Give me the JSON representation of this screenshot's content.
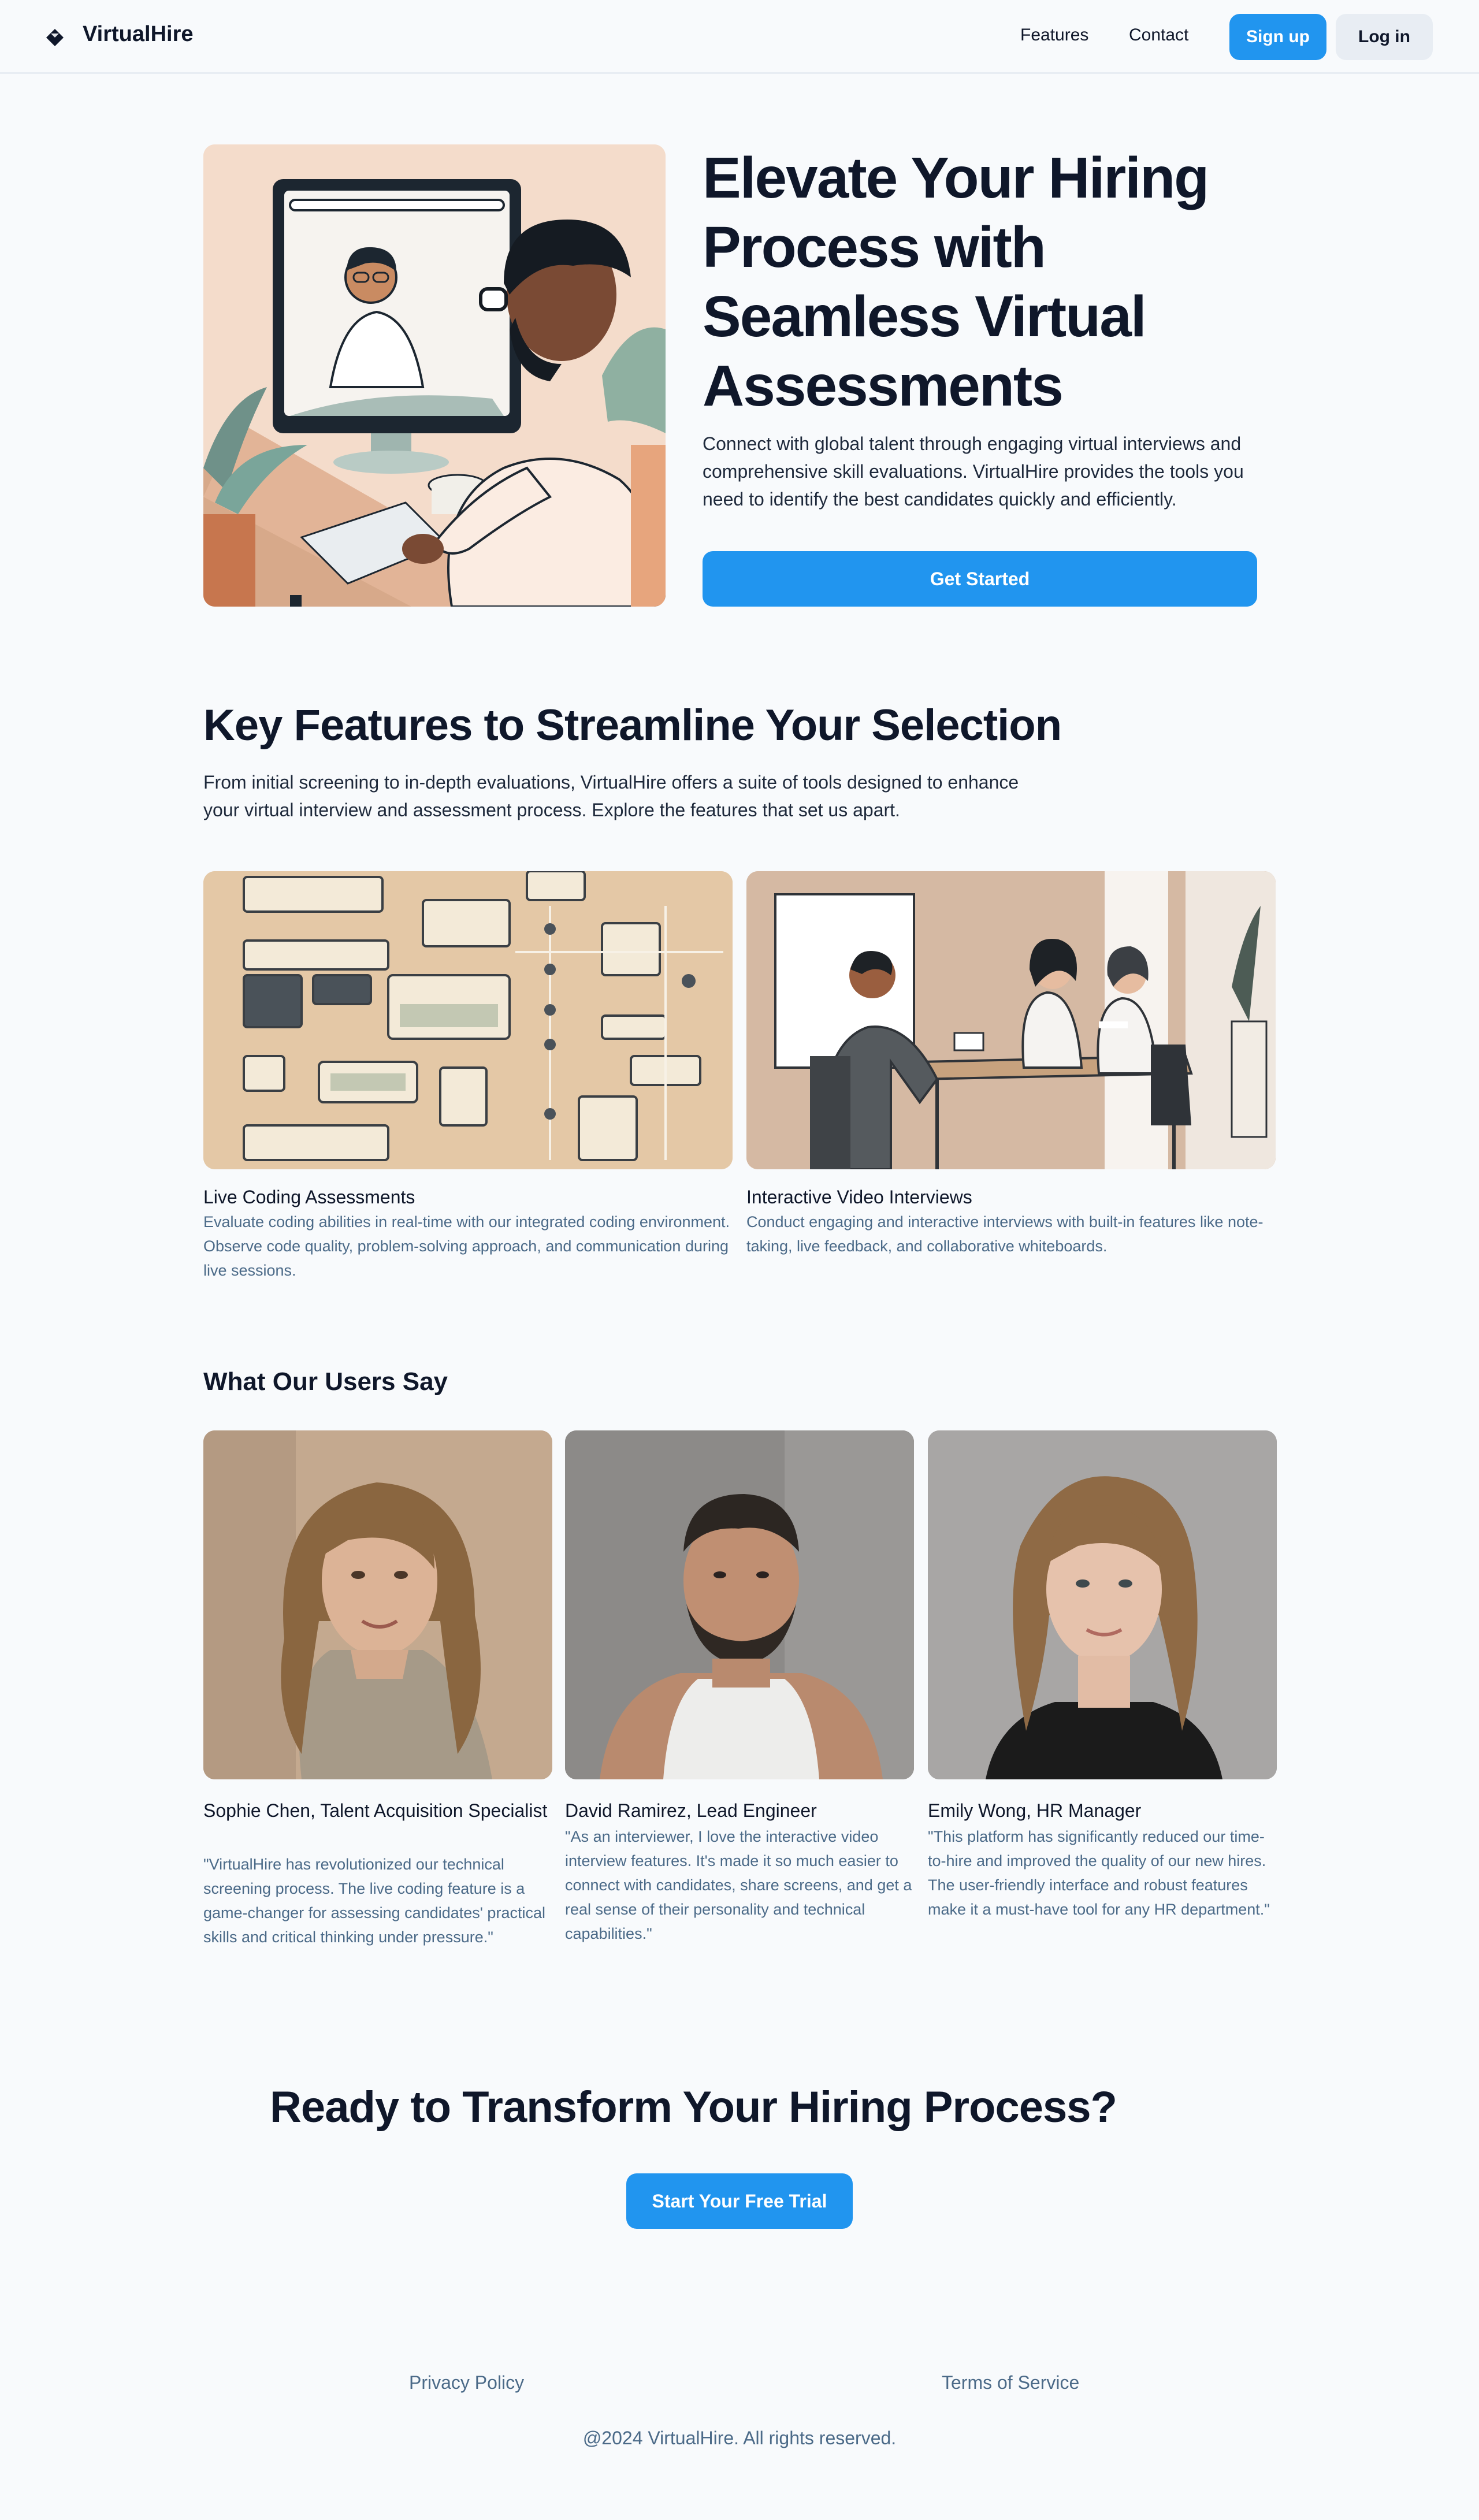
{
  "header": {
    "brand": "VirtualHire",
    "nav": {
      "features": "Features",
      "contact": "Contact"
    },
    "signup_label": "Sign up",
    "login_label": "Log in"
  },
  "hero": {
    "title": "Elevate Your Hiring Process with Seamless Virtual Assessments",
    "description": "Connect with global talent through engaging virtual interviews and comprehensive skill evaluations. VirtualHire provides the tools you need to identify the best candidates quickly and efficiently.",
    "cta_label": "Get Started"
  },
  "features": {
    "title": "Key Features to Streamline Your Selection",
    "description": "From initial screening to in-depth evaluations, VirtualHire offers a suite of tools designed to enhance your virtual interview and assessment process. Explore the features that set us apart.",
    "items": [
      {
        "name": "Live Coding Assessments",
        "text": "Evaluate coding abilities in real-time with our integrated coding environment. Observe code quality, problem-solving approach, and communication during live sessions."
      },
      {
        "name": "Interactive Video Interviews",
        "text": "Conduct engaging and interactive interviews with built-in features like note-taking, live feedback, and collaborative whiteboards."
      }
    ]
  },
  "testimonials": {
    "title": "What Our Users Say",
    "items": [
      {
        "name": "Sophie Chen, Talent Acquisition Specialist",
        "quote": "\"VirtualHire has revolutionized our technical screening process. The live coding feature is a game-changer for assessing candidates' practical skills and critical thinking under pressure.\""
      },
      {
        "name": "David Ramirez, Lead Engineer",
        "quote": "\"As an interviewer, I love the interactive video interview features. It's made it so much easier to connect with candidates, share screens, and get a real sense of their personality and technical capabilities.\""
      },
      {
        "name": "Emily Wong, HR Manager",
        "quote": "\"This platform has significantly reduced our time-to-hire and improved the quality of our new hires. The user-friendly interface and robust features make it a must-have tool for any HR department.\""
      }
    ]
  },
  "cta": {
    "title": "Ready to Transform Your Hiring Process?",
    "button_label": "Start Your Free Trial"
  },
  "footer": {
    "privacy": "Privacy Policy",
    "terms": "Terms of Service",
    "copyright": "@2024 VirtualHire. All rights reserved."
  },
  "colors": {
    "accent": "#2195ef",
    "muted_text": "#4b6a88",
    "background": "#f8fafc"
  },
  "icons": {
    "logo": "diamond-logo-icon"
  }
}
